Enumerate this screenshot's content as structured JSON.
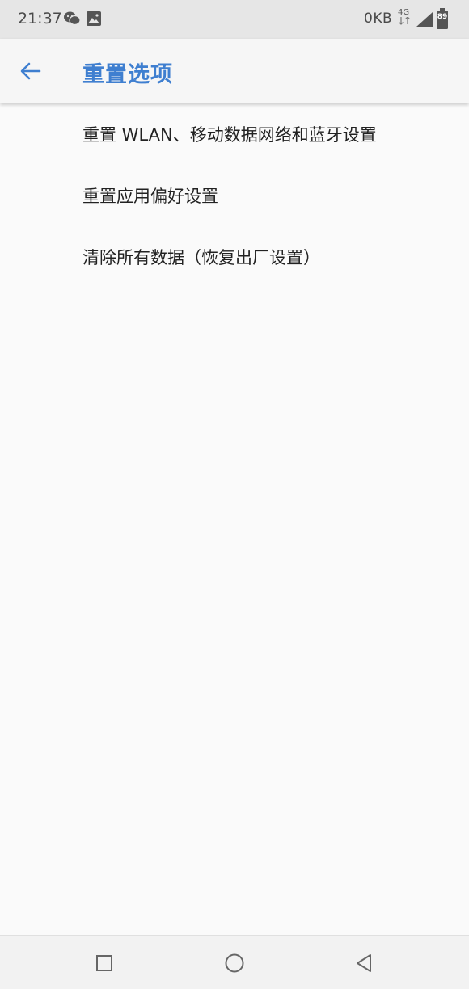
{
  "status_bar": {
    "time": "21:37",
    "network_speed": "0KB",
    "network_type": "4G",
    "battery_level": "89",
    "icons": [
      "wechat-icon",
      "gallery-icon",
      "signal-icon",
      "battery-icon"
    ]
  },
  "app_bar": {
    "title": "重置选项",
    "back_icon": "arrow-left-icon",
    "accent_color": "#3f7fd0"
  },
  "reset_options": [
    {
      "label": "重置 WLAN、移动数据网络和蓝牙设置"
    },
    {
      "label": "重置应用偏好设置"
    },
    {
      "label": "清除所有数据（恢复出厂设置）"
    }
  ],
  "nav_bar": {
    "icons": [
      "recents-square-icon",
      "home-circle-icon",
      "back-triangle-icon"
    ]
  }
}
